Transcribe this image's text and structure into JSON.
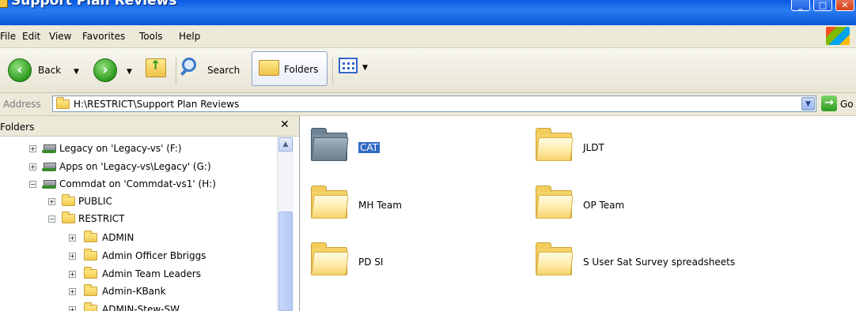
{
  "window": {
    "title": "Support Plan Reviews"
  },
  "menu": {
    "items": [
      "File",
      "Edit",
      "View",
      "Favorites",
      "Tools",
      "Help"
    ]
  },
  "toolbar": {
    "back_label": "Back",
    "search_label": "Search",
    "folders_label": "Folders"
  },
  "address": {
    "label": "Address",
    "value": "H:\\RESTRICT\\Support Plan Reviews",
    "go_label": "Go"
  },
  "folders_pane": {
    "title": "Folders",
    "close_glyph": "✕",
    "tree": [
      {
        "label": "Legacy on 'Legacy-vs' (F:)",
        "expander": "+",
        "icon": "network-drive-icon"
      },
      {
        "label": "Apps on 'Legacy-vs\\Legacy' (G:)",
        "expander": "+",
        "icon": "network-drive-icon"
      },
      {
        "label": "Commdat on 'Commdat-vs1' (H:)",
        "expander": "−",
        "icon": "network-drive-icon"
      },
      {
        "label": "PUBLIC",
        "expander": "+",
        "icon": "folder-icon"
      },
      {
        "label": "RESTRICT",
        "expander": "−",
        "icon": "folder-icon"
      },
      {
        "label": "ADMIN",
        "expander": "+",
        "icon": "folder-icon"
      },
      {
        "label": "Admin Officer Bbriggs",
        "expander": "+",
        "icon": "folder-icon"
      },
      {
        "label": "Admin Team Leaders",
        "expander": "+",
        "icon": "folder-icon"
      },
      {
        "label": "Admin-KBank",
        "expander": "+",
        "icon": "folder-icon"
      },
      {
        "label": "ADMIN-Stew-SW",
        "expander": "+",
        "icon": "folder-icon"
      }
    ]
  },
  "content": {
    "items": [
      {
        "label": "CAT",
        "selected": true
      },
      {
        "label": "JLDT",
        "selected": false
      },
      {
        "label": "MH Team",
        "selected": false
      },
      {
        "label": "OP Team",
        "selected": false
      },
      {
        "label": "PD SI",
        "selected": false
      },
      {
        "label": "S User Sat Survey spreadsheets",
        "selected": false
      }
    ]
  },
  "colors": {
    "selection": "#316ac5",
    "desktop": "#c9f7ff",
    "titlebar": "#0a5ae3"
  }
}
